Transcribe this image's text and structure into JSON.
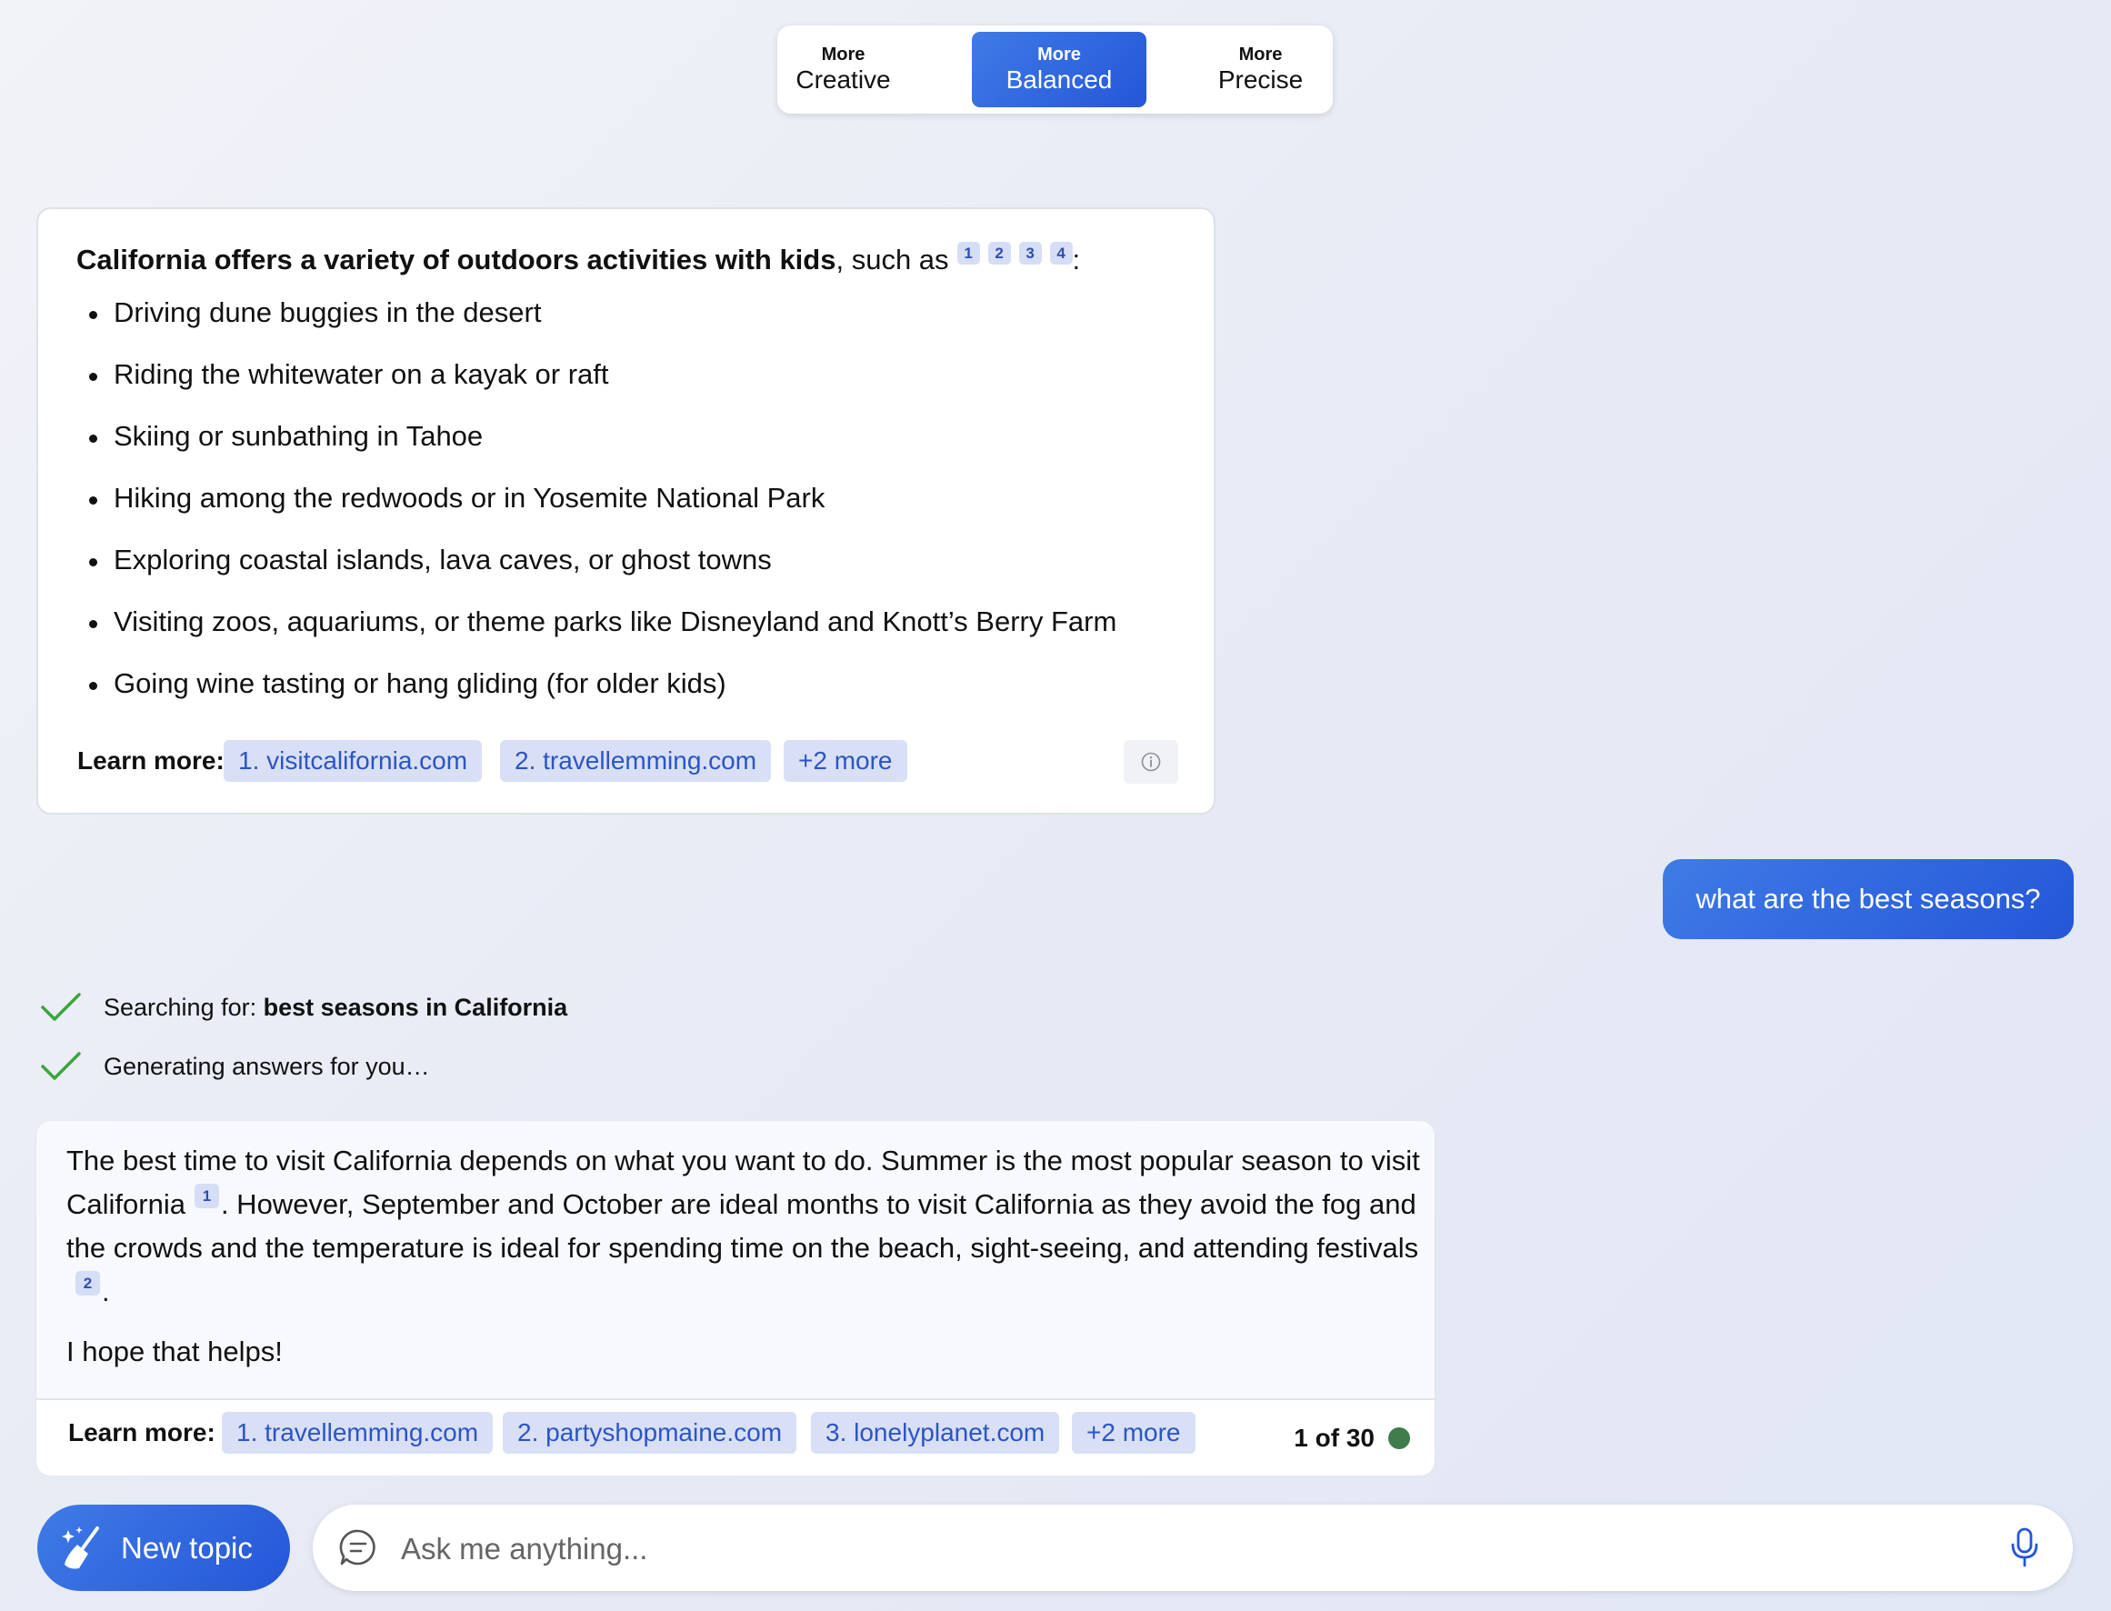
{
  "tones": [
    {
      "top": "More",
      "label": "Creative",
      "active": false
    },
    {
      "top": "More",
      "label": "Balanced",
      "active": true
    },
    {
      "top": "More",
      "label": "Precise",
      "active": false
    }
  ],
  "first_answer": {
    "intro_bold": "California offers a variety of outdoors activities with kids",
    "intro_rest": ", such as",
    "citations": [
      "1",
      "2",
      "3",
      "4"
    ],
    "intro_end": ":",
    "bullets": [
      "Driving dune buggies in the desert",
      "Riding the whitewater on a kayak or raft",
      "Skiing or sunbathing in Tahoe",
      "Hiking among the redwoods or in Yosemite National Park",
      "Exploring coastal islands, lava caves, or ghost towns",
      "Visiting zoos, aquariums, or theme parks like Disneyland and Knott’s Berry Farm",
      "Going wine tasting or hang gliding (for older kids)"
    ],
    "learn_more_label": "Learn more:",
    "sources": [
      "1. visitcalifornia.com",
      "2. travellemming.com",
      "+2 more"
    ]
  },
  "user_message": "what are the best seasons?",
  "status": {
    "searching_prefix": "Searching for: ",
    "searching_query": "best seasons in California",
    "generating": "Generating answers for you…"
  },
  "second_answer": {
    "part1": "The best time to visit California depends on what you want to do. Summer is the most popular season to visit California",
    "cite1": "1",
    "part2": ". However, September and October are ideal months to visit California as they avoid the fog and the crowds and the temperature is ideal for spending time on the beach, sight-seeing, and attending festivals",
    "cite2": "2",
    "part3": ".",
    "closing": "I hope that helps!",
    "learn_more_label": "Learn more:",
    "sources": [
      "1. travellemming.com",
      "2. partyshopmaine.com",
      "3. lonelyplanet.com",
      "+2 more"
    ],
    "page_count": "1 of 30"
  },
  "bottom": {
    "new_topic": "New topic",
    "ask_placeholder": "Ask me anything..."
  },
  "colors": {
    "accent": "#2456d8",
    "citation_bg": "#d6ddf7",
    "check_green": "#3aa63a",
    "status_dot": "#3e7c4c"
  },
  "icons": {
    "new_topic": "broom-sparkle-icon",
    "ask": "chat-bubble-icon",
    "mic": "microphone-icon",
    "info": "info-icon",
    "check": "checkmark-icon"
  }
}
